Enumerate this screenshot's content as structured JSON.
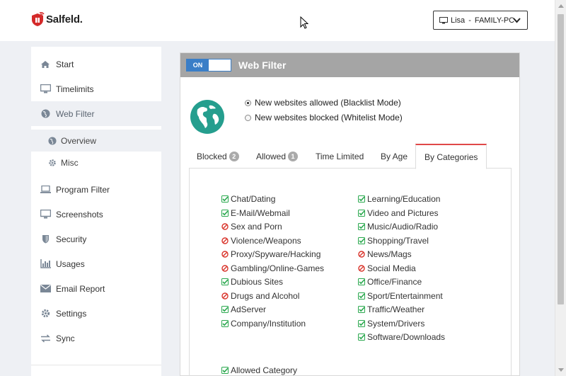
{
  "colors": {
    "accent": "#3a7ec7",
    "allowed": "#2aa84e",
    "blocked": "#d9342b",
    "header_bar": "#a5a5a5",
    "globe": "#259e8e"
  },
  "header": {
    "logo_text": "Salfeld.",
    "user": "Lisa",
    "separator": "-",
    "computer": "FAMILY-PC"
  },
  "sidebar": {
    "items": [
      {
        "label": "Start",
        "icon": "home-icon"
      },
      {
        "label": "Timelimits",
        "icon": "monitor-icon"
      },
      {
        "label": "Web Filter",
        "icon": "globe-icon",
        "active": true
      },
      {
        "label": "Program Filter",
        "icon": "laptop-icon"
      },
      {
        "label": "Screenshots",
        "icon": "desktop-icon"
      },
      {
        "label": "Security",
        "icon": "shield-icon"
      },
      {
        "label": "Usages",
        "icon": "bar-chart-icon"
      },
      {
        "label": "Email Report",
        "icon": "envelope-icon"
      },
      {
        "label": "Settings",
        "icon": "gear-icon"
      },
      {
        "label": "Sync",
        "icon": "sync-arrows-icon"
      }
    ],
    "sub_items": [
      {
        "label": "Overview",
        "icon": "globe-icon",
        "active": true
      },
      {
        "label": "Misc",
        "icon": "gear-icon"
      }
    ]
  },
  "panel": {
    "toggle_label": "ON",
    "title": "Web Filter",
    "modes": [
      {
        "label": "New websites allowed  (Blacklist Mode)",
        "checked": true
      },
      {
        "label": "New websites blocked  (Whitelist Mode)",
        "checked": false
      }
    ],
    "tabs": [
      {
        "label": "Blocked",
        "count": "2"
      },
      {
        "label": "Allowed",
        "count": "1"
      },
      {
        "label": "Time Limited"
      },
      {
        "label": "By Age"
      },
      {
        "label": "By Categories",
        "active": true
      }
    ],
    "categories_left": [
      {
        "label": "Chat/Dating",
        "status": "allowed"
      },
      {
        "label": "E-Mail/Webmail",
        "status": "allowed"
      },
      {
        "label": "Sex and Porn",
        "status": "blocked"
      },
      {
        "label": "Violence/Weapons",
        "status": "blocked"
      },
      {
        "label": "Proxy/Spyware/Hacking",
        "status": "blocked"
      },
      {
        "label": "Gambling/Online-Games",
        "status": "blocked"
      },
      {
        "label": "Dubious Sites",
        "status": "allowed"
      },
      {
        "label": "Drugs and Alcohol",
        "status": "blocked"
      },
      {
        "label": "AdServer",
        "status": "allowed"
      },
      {
        "label": "Company/Institution",
        "status": "allowed"
      }
    ],
    "categories_right": [
      {
        "label": "Learning/Education",
        "status": "allowed"
      },
      {
        "label": "Video and Pictures",
        "status": "allowed"
      },
      {
        "label": "Music/Audio/Radio",
        "status": "allowed"
      },
      {
        "label": "Shopping/Travel",
        "status": "allowed"
      },
      {
        "label": "News/Mags",
        "status": "blocked"
      },
      {
        "label": "Social Media",
        "status": "blocked"
      },
      {
        "label": "Office/Finance",
        "status": "allowed"
      },
      {
        "label": "Sport/Entertainment",
        "status": "allowed"
      },
      {
        "label": "Traffic/Weather",
        "status": "allowed"
      },
      {
        "label": "System/Drivers",
        "status": "allowed"
      },
      {
        "label": "Software/Downloads",
        "status": "allowed"
      }
    ],
    "legend_allowed": "Allowed Category"
  }
}
